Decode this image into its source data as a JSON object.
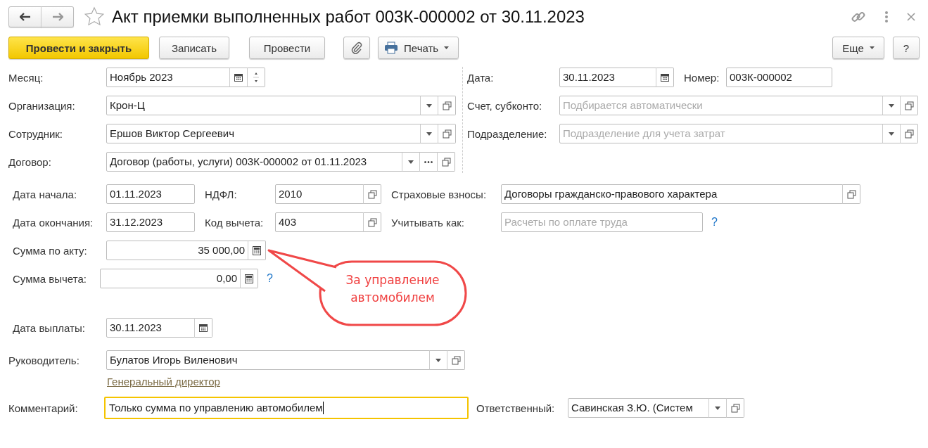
{
  "window": {
    "title": "Акт приемки выполненных работ 003К-000002 от 30.11.2023",
    "favorite": false
  },
  "toolbar": [
    {
      "label": "Провести и закрыть",
      "kind": "primary"
    },
    {
      "label": "Записать",
      "kind": "plain"
    },
    {
      "label": "Провести",
      "kind": "plain"
    },
    {
      "kind": "attach"
    },
    {
      "label": "Печать",
      "kind": "print"
    },
    {
      "label": "Еще",
      "kind": "menu"
    },
    {
      "label": "?",
      "kind": "help"
    }
  ],
  "header_left": [
    {
      "label": "Месяц:",
      "value": "Ноябрь 2023"
    },
    {
      "label": "Организация:",
      "value": "Крон-Ц"
    },
    {
      "label": "Сотрудник:",
      "value": "Ершов Виктор Сергеевич"
    },
    {
      "label": "Договор:",
      "value": "Договор (работы, услуги) 003К-000002 от 01.11.2023"
    }
  ],
  "header_right": [
    {
      "label": "Дата:",
      "value": "30.11.2023"
    },
    {
      "label": "Номер:",
      "value": "003К-000002"
    },
    {
      "label": "Счет, субконто:",
      "placeholder": "Подбирается автоматически"
    },
    {
      "label": "Подразделение:",
      "placeholder": "Подразделение для учета затрат"
    }
  ],
  "details": [
    {
      "label": "Дата начала:",
      "value": "01.11.2023"
    },
    {
      "label": "НДФЛ:",
      "value": "2010"
    },
    {
      "label": "Страховые взносы:",
      "value": "Договоры гражданско-правового характера"
    },
    {
      "label": "Дата окончания:",
      "value": "31.12.2023"
    },
    {
      "label": "Код вычета:",
      "value": "403"
    },
    {
      "label": "Учитывать как:",
      "placeholder": "Расчеты по оплате труда",
      "help": "?"
    },
    {
      "label": "Сумма по акту:",
      "value": "35 000,00"
    },
    {
      "label": "Сумма вычета:",
      "value": "0,00",
      "help": "?"
    },
    {
      "label": "Дата выплаты:",
      "value": "30.11.2023"
    }
  ],
  "manager": {
    "label": "Руководитель:",
    "value": "Булатов Игорь Виленович",
    "position": "Генеральный директор"
  },
  "comment": {
    "label": "Комментарий:",
    "value": "Только сумма по управлению автомобилем",
    "focused": true
  },
  "responsible": {
    "label": "Ответственный:",
    "value": "Савинская З.Ю. (Систем"
  },
  "callout": {
    "text": "За управление автомобилем"
  }
}
